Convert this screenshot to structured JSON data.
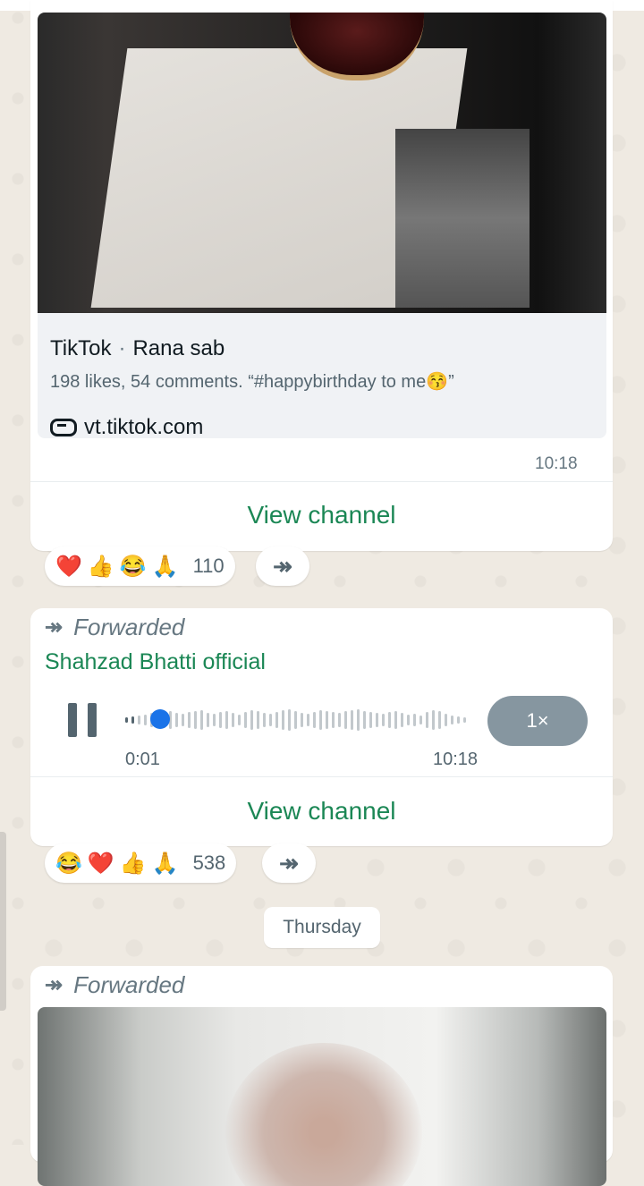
{
  "card1": {
    "link_source": "TikTok",
    "link_separator": "·",
    "link_author": "Rana sab",
    "link_description": "198 likes, 54 comments. “#happybirthday to me😚”",
    "link_url": "vt.tiktok.com",
    "time": "10:18",
    "view_channel": "View channel"
  },
  "reactions1": {
    "emojis": [
      "❤️",
      "👍",
      "😂",
      "🙏"
    ],
    "count": "110"
  },
  "card2": {
    "forwarded_label": "Forwarded",
    "sender": "Shahzad Bhatti official",
    "audio_elapsed": "0:01",
    "audio_time": "10:18",
    "speed": "1×",
    "audio_progress": 0.04,
    "view_channel": "View channel"
  },
  "reactions2": {
    "emojis": [
      "😂",
      "❤️",
      "👍",
      "🙏"
    ],
    "count": "538"
  },
  "date_chip": "Thursday",
  "card3": {
    "forwarded_label": "Forwarded"
  },
  "icons": {
    "forward": "forward-icon",
    "link": "link-icon",
    "pause": "pause-icon"
  },
  "colors": {
    "accent_green": "#1b8755",
    "chat_background": "#efeae2",
    "audio_knob": "#1a73e8"
  }
}
